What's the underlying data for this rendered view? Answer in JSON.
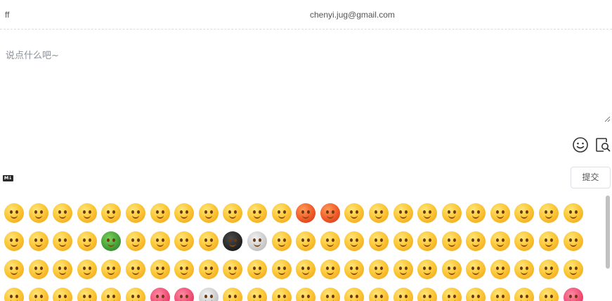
{
  "form": {
    "nick": "ff",
    "mail": "chenyi.jug@gmail.com",
    "comment_placeholder": "说点什么吧~"
  },
  "toolbar": {
    "emoji_icon": "emoji-smile-icon",
    "preview_icon": "preview-icon",
    "markdown_badge": "M↓"
  },
  "submit_label": "提交",
  "emoji_panel": {
    "row_count_visible": 4,
    "columns": 24
  },
  "colors": {
    "border": "#dcdfe6",
    "placeholder": "#8a8f99",
    "scroll_thumb": "#c1c1c1"
  }
}
